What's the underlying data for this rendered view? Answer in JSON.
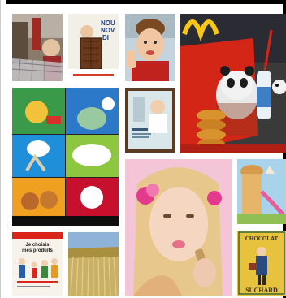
{
  "gallery": {
    "tiles": [
      {
        "id": "shopping-cart-child",
        "texts": []
      },
      {
        "id": "chocolate-bar-boy",
        "texts": [
          "NOU",
          "NOV",
          "DI"
        ]
      },
      {
        "id": "boy-eating",
        "texts": []
      },
      {
        "id": "happy-meal-panda",
        "texts": []
      },
      {
        "id": "cartoon-comic-grid",
        "texts": []
      },
      {
        "id": "magazine-baby-ad",
        "texts": []
      },
      {
        "id": "girl-lipstick",
        "texts": []
      },
      {
        "id": "pastry-slide",
        "texts": []
      },
      {
        "id": "family-poster",
        "texts": [
          "Je choisis",
          "mes produits"
        ]
      },
      {
        "id": "wheat-field",
        "texts": []
      },
      {
        "id": "chocolat-suchard",
        "texts": [
          "CHOCOLAT",
          "SUCHARD"
        ]
      }
    ]
  }
}
